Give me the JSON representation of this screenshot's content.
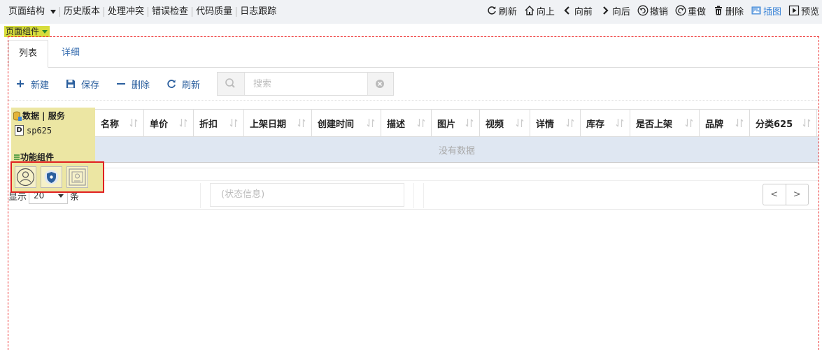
{
  "menu": {
    "items": [
      "页面结构",
      "历史版本",
      "处理冲突",
      "错误检查",
      "代码质量",
      "日志跟踪"
    ]
  },
  "toolbar": {
    "refresh": "刷新",
    "up": "向上",
    "prev": "向前",
    "next": "向后",
    "undo": "撤销",
    "redo": "重做",
    "delete": "删除",
    "insert_image": "插图",
    "preview": "预览"
  },
  "component_tag": "页面组件",
  "tabs": [
    "列表",
    "详细"
  ],
  "actions": {
    "new": "新建",
    "save": "保存",
    "delete": "删除",
    "refresh": "刷新"
  },
  "search": {
    "placeholder": "搜索",
    "value": ""
  },
  "table": {
    "columns": [
      "名称",
      "单价",
      "折扣",
      "上架日期",
      "创建时间",
      "描述",
      "图片",
      "视频",
      "详情",
      "库存",
      "是否上架",
      "品牌",
      "分类625"
    ],
    "empty_text": "没有数据"
  },
  "panel": {
    "data_header": "数据 | 服务",
    "service_name": "sp625",
    "components_header": "功能组件"
  },
  "footer": {
    "show_prefix": "显示",
    "page_size": "20",
    "show_suffix": "条",
    "status": "(状态信息)",
    "prev": "<",
    "next": ">"
  },
  "colors": {
    "accent": "#3d86d8",
    "action_blue": "#2b5f9e",
    "highlight_red": "#e02020",
    "panel_yellow": "#ece6a3",
    "tag_yellow": "#d7dd3c",
    "empty_row_bg": "#dfe7f2"
  }
}
